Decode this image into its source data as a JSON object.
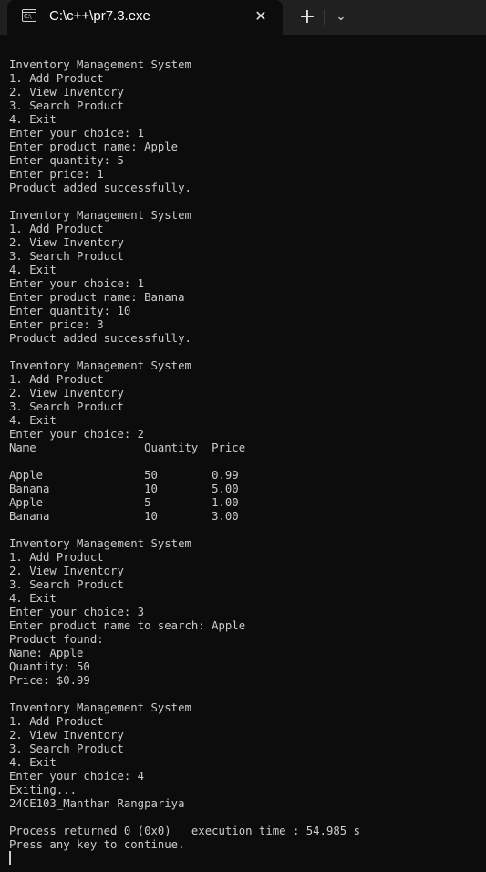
{
  "window": {
    "tab_icon_glyph": "C:\\",
    "tab_title": "C:\\c++\\pr7.3.exe",
    "close_glyph": "✕",
    "new_tab_glyph": "+",
    "dropdown_glyph": "⌄"
  },
  "console": {
    "lines": [
      "Inventory Management System",
      "1. Add Product",
      "2. View Inventory",
      "3. Search Product",
      "4. Exit",
      "Enter your choice: 1",
      "Enter product name: Apple",
      "Enter quantity: 5",
      "Enter price: 1",
      "Product added successfully.",
      "",
      "Inventory Management System",
      "1. Add Product",
      "2. View Inventory",
      "3. Search Product",
      "4. Exit",
      "Enter your choice: 1",
      "Enter product name: Banana",
      "Enter quantity: 10",
      "Enter price: 3",
      "Product added successfully.",
      "",
      "Inventory Management System",
      "1. Add Product",
      "2. View Inventory",
      "3. Search Product",
      "4. Exit",
      "Enter your choice: 2",
      "Name                Quantity  Price",
      "--------------------------------------------",
      "Apple               50        0.99",
      "Banana              10        5.00",
      "Apple               5         1.00",
      "Banana              10        3.00",
      "",
      "Inventory Management System",
      "1. Add Product",
      "2. View Inventory",
      "3. Search Product",
      "4. Exit",
      "Enter your choice: 3",
      "Enter product name to search: Apple",
      "Product found:",
      "Name: Apple",
      "Quantity: 50",
      "Price: $0.99",
      "",
      "Inventory Management System",
      "1. Add Product",
      "2. View Inventory",
      "3. Search Product",
      "4. Exit",
      "Enter your choice: 4",
      "Exiting...",
      "24CE103_Manthan Rangpariya",
      "",
      "Process returned 0 (0x0)   execution time : 54.985 s",
      "Press any key to continue."
    ]
  }
}
